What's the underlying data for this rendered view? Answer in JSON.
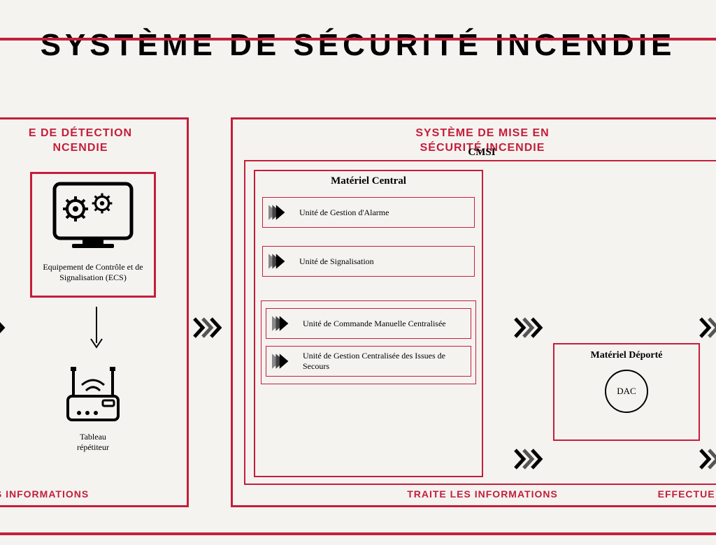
{
  "title": "SYSTÈME DE SÉCURITÉ INCENDIE",
  "detection": {
    "panel_title_line1": "E DE DÉTECTION",
    "panel_title_line2": "NCENDIE",
    "ecs_label": "Equipement de Contrôle et de Signalisation (ECS)",
    "repeater_label_line1": "Tableau",
    "repeater_label_line2": "répétiteur",
    "caption": "LES INFORMATIONS"
  },
  "securite": {
    "panel_title_line1": "SYSTÈME DE MISE EN",
    "panel_title_line2": "SÉCURITÉ INCENDIE",
    "cmsi_label": "CMSI",
    "material_central_title": "Matériel Central",
    "units": {
      "uga": "Unité de Gestion d'Alarme",
      "us": "Unité de Signalisation",
      "ucmc": "Unité de Commande Manuelle Centralisée",
      "ugcis": "Unité de Gestion Centralisée des Issues de Secours"
    },
    "material_deporte_title": "Matériel Déporté",
    "dac_label": "DAC",
    "caption_center": "TRAITE LES INFORMATIONS",
    "caption_right": "EFFECTUE L"
  }
}
